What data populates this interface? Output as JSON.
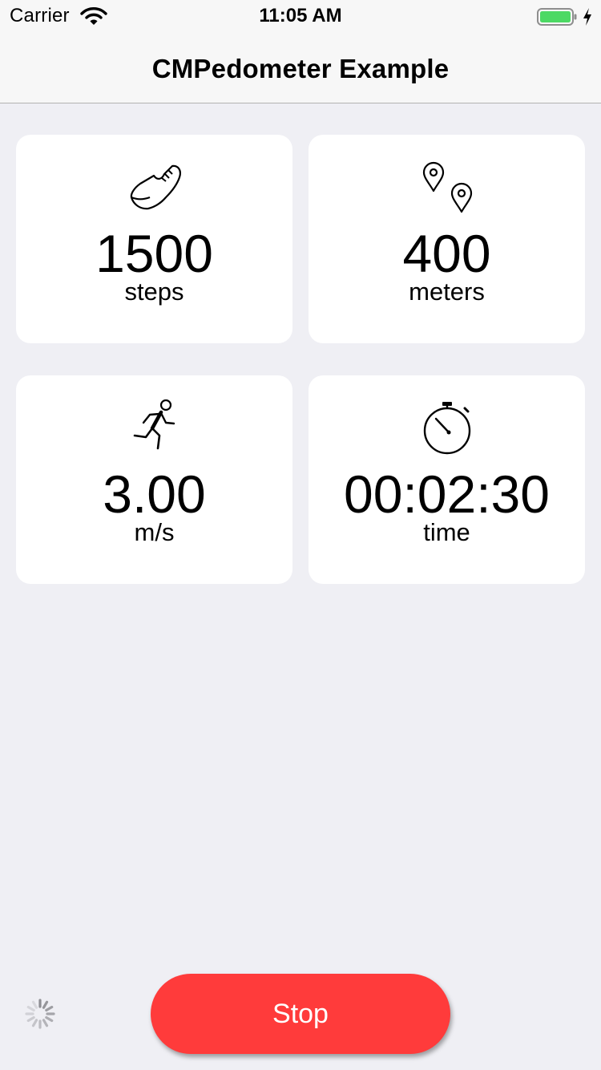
{
  "status_bar": {
    "carrier": "Carrier",
    "time": "11:05 AM",
    "wifi_icon": "wifi-icon",
    "battery_icon": "battery-charging-icon",
    "battery_color": "#4cd964"
  },
  "nav": {
    "title": "CMPedometer Example"
  },
  "stats": {
    "steps": {
      "icon": "sneaker-icon",
      "value": "1500",
      "unit": "steps"
    },
    "distance": {
      "icon": "map-pins-icon",
      "value": "400",
      "unit": "meters"
    },
    "pace": {
      "icon": "runner-icon",
      "value": "3.00",
      "unit": "m/s"
    },
    "time": {
      "icon": "stopwatch-icon",
      "value": "00:02:30",
      "unit": "time"
    }
  },
  "footer": {
    "activity_indicator": "spinner-icon",
    "stop_label": "Stop",
    "stop_color": "#ff3b3b"
  }
}
